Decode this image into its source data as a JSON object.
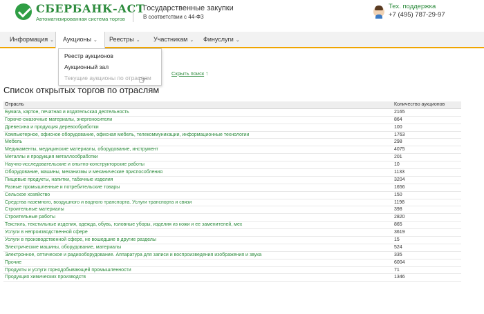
{
  "header": {
    "logo_name": "СБЕРБАНК-АСТ",
    "logo_subtitle": "Автоматизированная система торгов",
    "site_title": "Государственные закупки",
    "site_subtitle": "В соответствии с 44-ФЗ",
    "support_label": "Тех. поддержка",
    "support_phone": "+7 (495) 787-29-97"
  },
  "nav": [
    {
      "label": "Информация"
    },
    {
      "label": "Аукционы"
    },
    {
      "label": "Реестры"
    },
    {
      "label": "Участникам"
    },
    {
      "label": "Финуслуги"
    }
  ],
  "dropdown": [
    {
      "label": "Реестр аукционов"
    },
    {
      "label": "Аукционный зал"
    },
    {
      "label": "Текущие аукционы по отраслям"
    }
  ],
  "show_search": "Скрыть поиск",
  "page_title": "Список открытых торгов по отраслям",
  "table": {
    "col_industry": "Отрасль",
    "col_count": "Количество аукционов",
    "rows": [
      {
        "name": "Бумага, картон, печатная и издательская деятельность",
        "count": "2165"
      },
      {
        "name": "Горюче-смазочные материалы, энергоносители",
        "count": "864"
      },
      {
        "name": "Древесина и продукция деревообработки",
        "count": "100"
      },
      {
        "name": "Компьютерное, офисное оборудование, офисная мебель, телекоммуникации, информационные технологии",
        "count": "1763"
      },
      {
        "name": "Мебель",
        "count": "298"
      },
      {
        "name": "Медикаменты, медицинские материалы, оборудование, инструмент",
        "count": "4075"
      },
      {
        "name": "Металлы и продукция металлообработки",
        "count": "201"
      },
      {
        "name": "Научно-исследовательские и опытно-конструкторские работы",
        "count": "10"
      },
      {
        "name": "Оборудование, машины, механизмы и механические приспособления",
        "count": "1133"
      },
      {
        "name": "Пищевые продукты, напитки, табачные изделия",
        "count": "3204"
      },
      {
        "name": "Разные промышленные и потребительские товары",
        "count": "1656"
      },
      {
        "name": "Сельское хозяйство",
        "count": "150"
      },
      {
        "name": "Средства наземного, воздушного и водного транспорта. Услуги транспорта и связи",
        "count": "1198"
      },
      {
        "name": "Строительные материалы",
        "count": "398"
      },
      {
        "name": "Строительные работы",
        "count": "2820"
      },
      {
        "name": "Текстиль, текстильные изделия, одежда, обувь, головные уборы, изделия из кожи и ее заменителей, мех",
        "count": "865"
      },
      {
        "name": "Услуги в непроизводственной сфере",
        "count": "3619"
      },
      {
        "name": "Услуги в производственной сфере, не вошедшие в другие разделы",
        "count": "15"
      },
      {
        "name": "Электрические машины, оборудование, материалы",
        "count": "524"
      },
      {
        "name": "Электронное, оптическое и радиооборудование. Аппаратура для записи и воспроизведения изображения и звука",
        "count": "335"
      },
      {
        "name": "Прочие",
        "count": "6004"
      },
      {
        "name": "Продукты и услуги горнодобывающей промышленности",
        "count": "71"
      },
      {
        "name": "Продукция химических производств",
        "count": "1346"
      }
    ]
  },
  "colors": {
    "brand_green": "#2c8b3c",
    "accent_orange": "#f0a500"
  }
}
